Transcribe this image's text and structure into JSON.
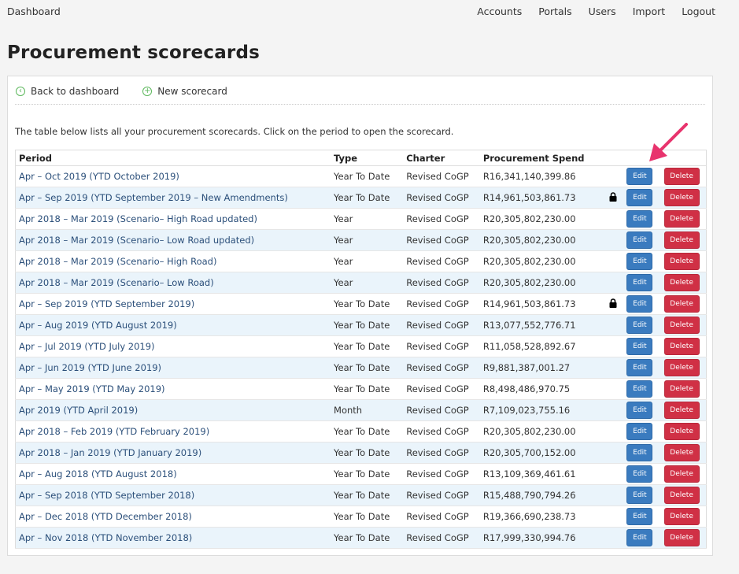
{
  "nav": {
    "brand": "Dashboard",
    "links": [
      "Accounts",
      "Portals",
      "Users",
      "Import",
      "Logout"
    ]
  },
  "page_title": "Procurement scorecards",
  "actions": {
    "back": "Back to dashboard",
    "new": "New scorecard"
  },
  "description": "The table below lists all your procurement scorecards. Click on the period to open the scorecard.",
  "table": {
    "headers": {
      "period": "Period",
      "type": "Type",
      "charter": "Charter",
      "spend": "Procurement Spend"
    },
    "edit_label": "Edit",
    "delete_label": "Delete",
    "rows": [
      {
        "period": "Apr – Oct 2019 (YTD October 2019)",
        "type": "Year To Date",
        "charter": "Revised CoGP",
        "spend": "R16,341,140,399.86",
        "locked": false
      },
      {
        "period": "Apr – Sep 2019 (YTD September 2019 – New Amendments)",
        "type": "Year To Date",
        "charter": "Revised CoGP",
        "spend": "R14,961,503,861.73",
        "locked": true
      },
      {
        "period": "Apr 2018 – Mar 2019 (Scenario– High Road updated)",
        "type": "Year",
        "charter": "Revised CoGP",
        "spend": "R20,305,802,230.00",
        "locked": false
      },
      {
        "period": "Apr 2018 – Mar 2019 (Scenario– Low Road updated)",
        "type": "Year",
        "charter": "Revised CoGP",
        "spend": "R20,305,802,230.00",
        "locked": false
      },
      {
        "period": "Apr 2018 – Mar 2019 (Scenario– High Road)",
        "type": "Year",
        "charter": "Revised CoGP",
        "spend": "R20,305,802,230.00",
        "locked": false
      },
      {
        "period": "Apr 2018 – Mar 2019 (Scenario– Low Road)",
        "type": "Year",
        "charter": "Revised CoGP",
        "spend": "R20,305,802,230.00",
        "locked": false
      },
      {
        "period": "Apr – Sep 2019 (YTD September 2019)",
        "type": "Year To Date",
        "charter": "Revised CoGP",
        "spend": "R14,961,503,861.73",
        "locked": true
      },
      {
        "period": "Apr – Aug 2019 (YTD August 2019)",
        "type": "Year To Date",
        "charter": "Revised CoGP",
        "spend": "R13,077,552,776.71",
        "locked": false
      },
      {
        "period": "Apr – Jul 2019 (YTD July 2019)",
        "type": "Year To Date",
        "charter": "Revised CoGP",
        "spend": "R11,058,528,892.67",
        "locked": false
      },
      {
        "period": "Apr – Jun 2019 (YTD June 2019)",
        "type": "Year To Date",
        "charter": "Revised CoGP",
        "spend": "R9,881,387,001.27",
        "locked": false
      },
      {
        "period": "Apr – May 2019 (YTD May 2019)",
        "type": "Year To Date",
        "charter": "Revised CoGP",
        "spend": "R8,498,486,970.75",
        "locked": false
      },
      {
        "period": "Apr 2019 (YTD April 2019)",
        "type": "Month",
        "charter": "Revised CoGP",
        "spend": "R7,109,023,755.16",
        "locked": false
      },
      {
        "period": "Apr 2018 – Feb 2019 (YTD February 2019)",
        "type": "Year To Date",
        "charter": "Revised CoGP",
        "spend": "R20,305,802,230.00",
        "locked": false
      },
      {
        "period": "Apr 2018 – Jan 2019 (YTD January 2019)",
        "type": "Year To Date",
        "charter": "Revised CoGP",
        "spend": "R20,305,700,152.00",
        "locked": false
      },
      {
        "period": "Apr – Aug 2018 (YTD August 2018)",
        "type": "Year To Date",
        "charter": "Revised CoGP",
        "spend": "R13,109,369,461.61",
        "locked": false
      },
      {
        "period": "Apr – Sep 2018 (YTD September 2018)",
        "type": "Year To Date",
        "charter": "Revised CoGP",
        "spend": "R15,488,790,794.26",
        "locked": false
      },
      {
        "period": "Apr – Dec 2018 (YTD December 2018)",
        "type": "Year To Date",
        "charter": "Revised CoGP",
        "spend": "R19,366,690,238.73",
        "locked": false
      },
      {
        "period": "Apr – Nov 2018 (YTD November 2018)",
        "type": "Year To Date",
        "charter": "Revised CoGP",
        "spend": "R17,999,330,994.76",
        "locked": false
      }
    ]
  },
  "colors": {
    "edit_button": "#3a7bbf",
    "delete_button": "#d03045",
    "row_alt": "#eaf4fb",
    "annotation_arrow": "#e8336d"
  }
}
